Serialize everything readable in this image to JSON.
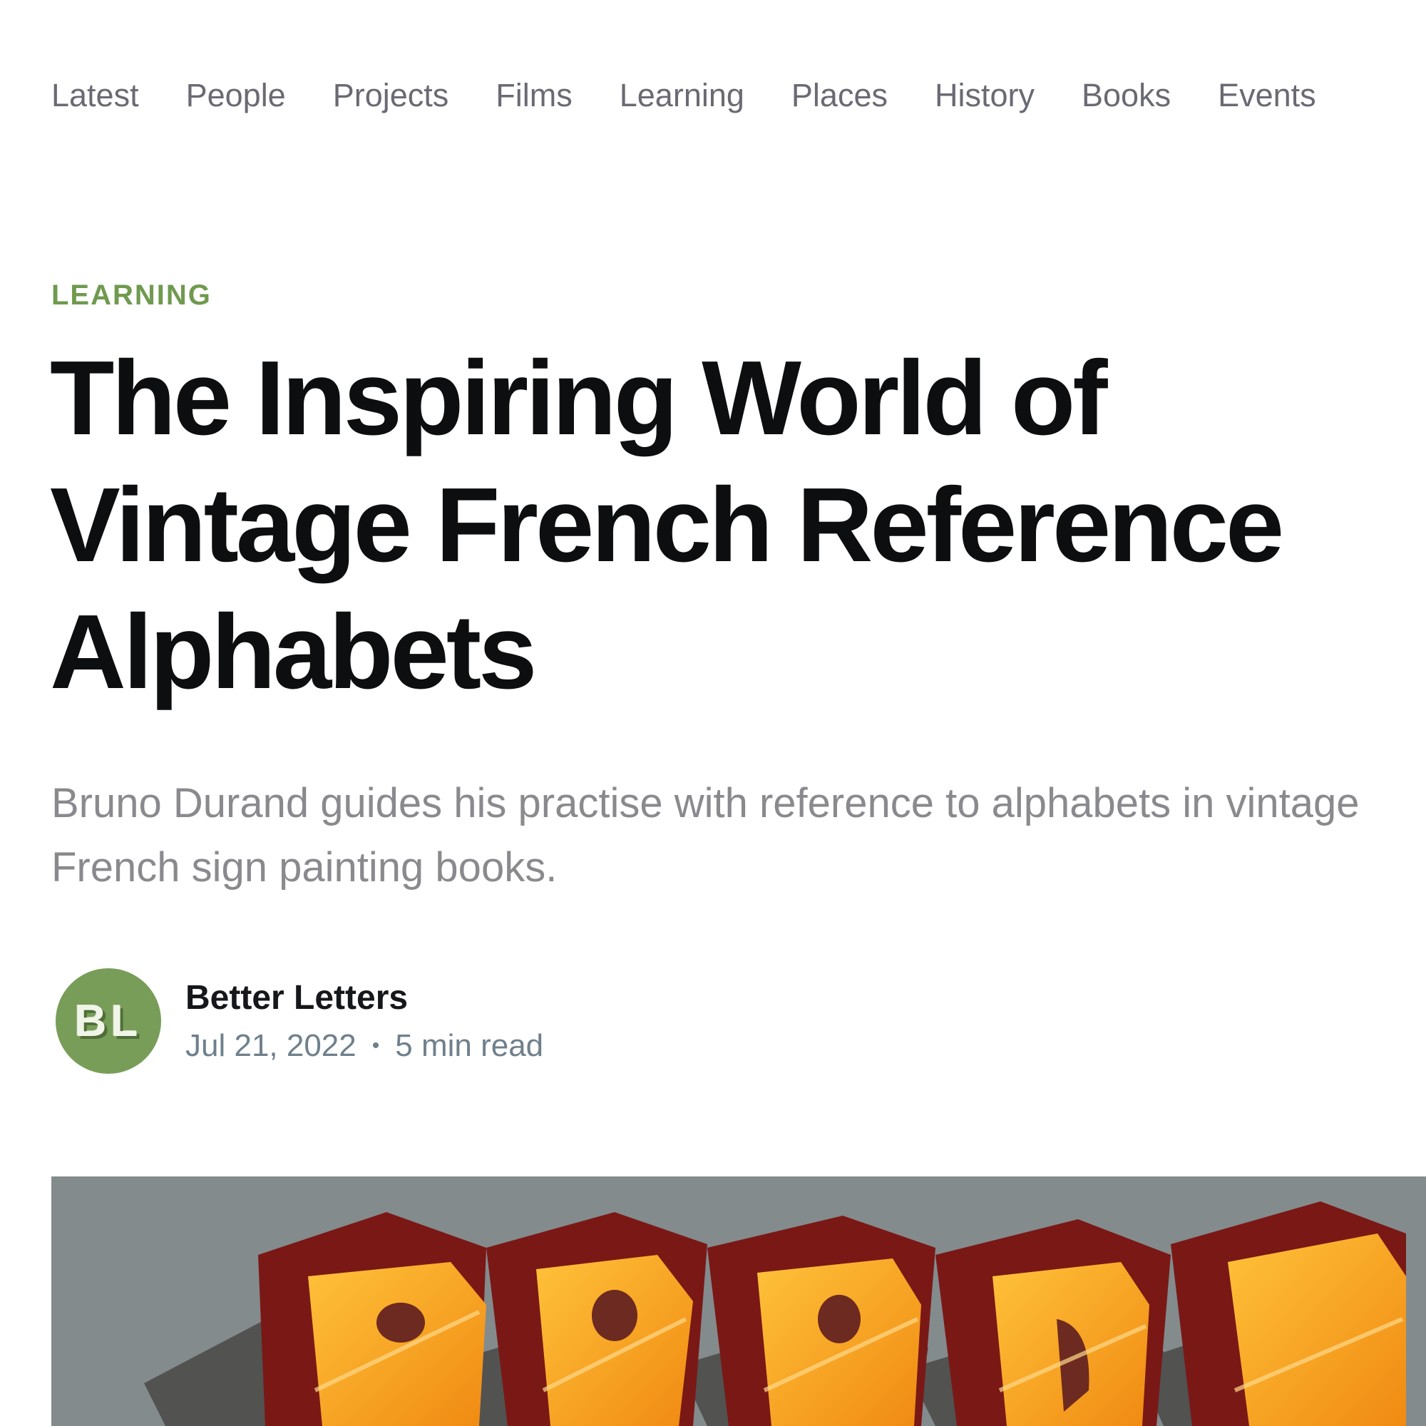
{
  "nav": {
    "items": [
      {
        "label": "Latest"
      },
      {
        "label": "People"
      },
      {
        "label": "Projects"
      },
      {
        "label": "Films"
      },
      {
        "label": "Learning"
      },
      {
        "label": "Places"
      },
      {
        "label": "History"
      },
      {
        "label": "Books"
      },
      {
        "label": "Events"
      }
    ]
  },
  "article": {
    "category": "LEARNING",
    "title": "The Inspiring World of Vintage French Reference Alphabets",
    "excerpt": "Bruno Durand guides his practise with reference to alphabets in vintage French sign painting books.",
    "author": {
      "initials": "BL",
      "name": "Better Letters"
    },
    "date": "Jul 21, 2022",
    "separator": "•",
    "reading_time": "5 min read"
  },
  "feature_image": {
    "letters": "BPRDN",
    "colors": {
      "background": "#828a8c",
      "letter_face": "#f7a21e",
      "letter_side": "#7a1816",
      "shadow": "#4a4846"
    }
  },
  "colors": {
    "accent": "#6f9a4f",
    "avatar": "#789d58",
    "headline": "#0c0e10",
    "excerpt": "#8a8a8e",
    "nav": "#6a6a74"
  }
}
